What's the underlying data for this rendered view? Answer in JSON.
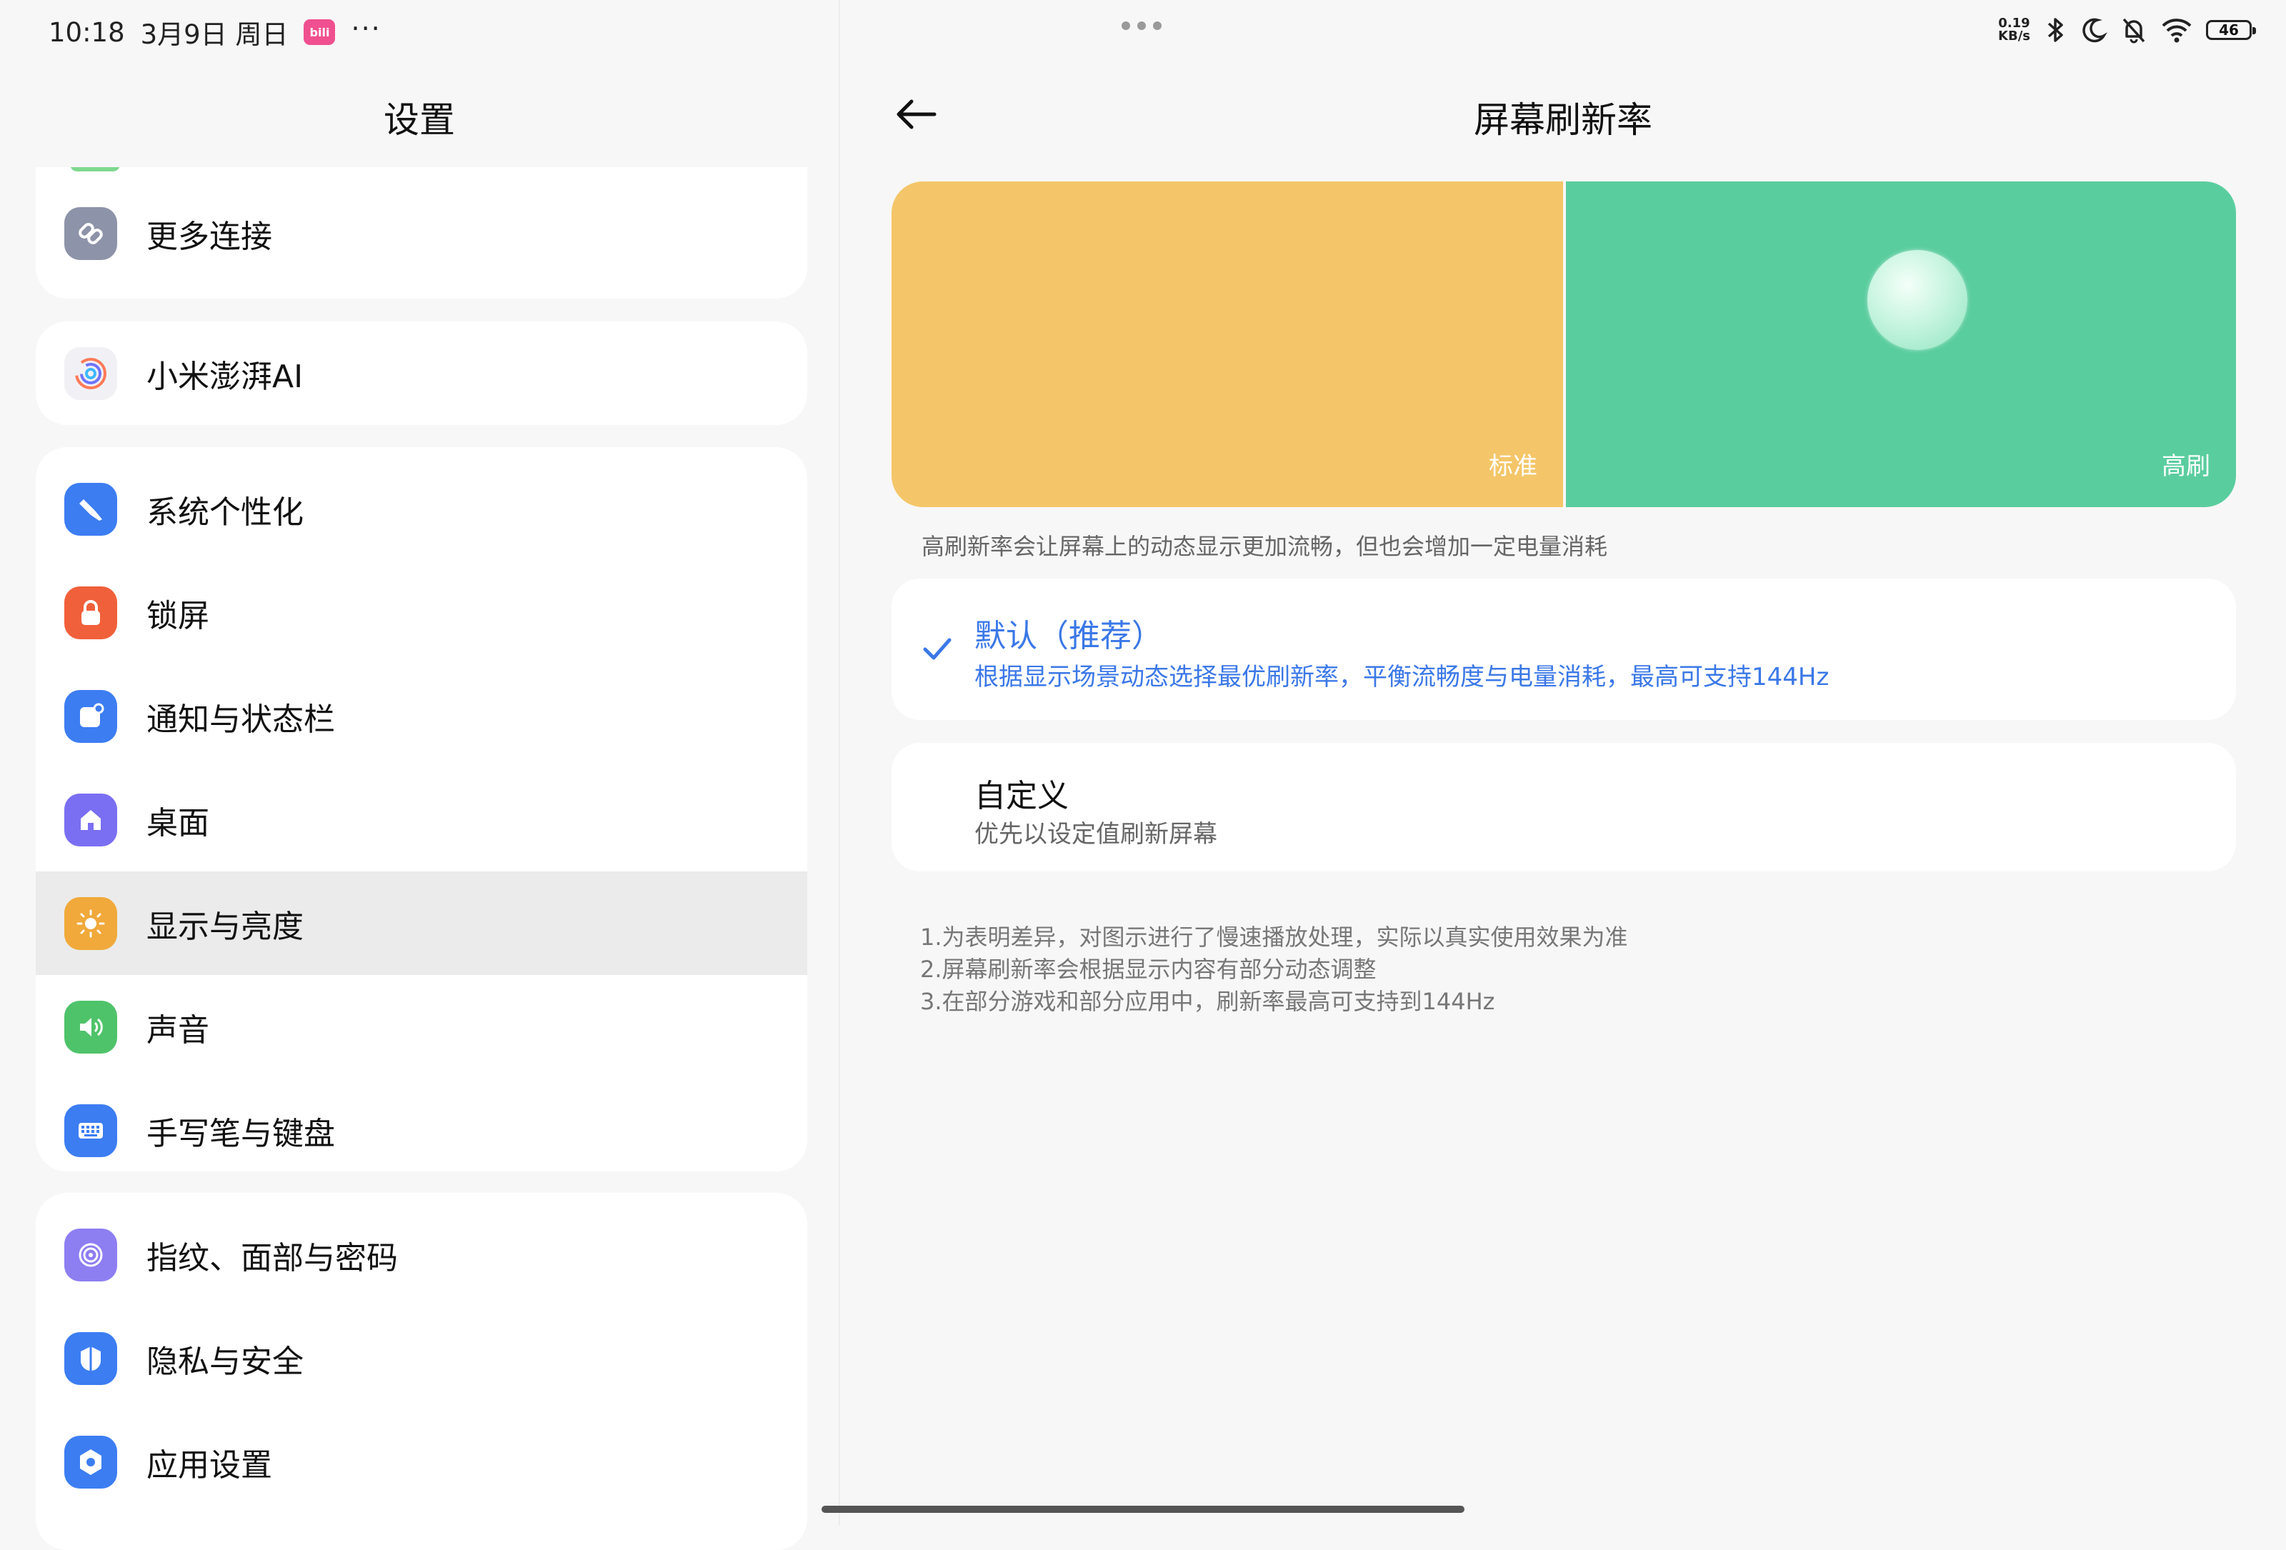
{
  "status_bar": {
    "time": "10:18",
    "date": "3月9日 周日",
    "app_badge": "bili",
    "more": "···",
    "net_speed_value": "0.19",
    "net_speed_unit": "KB/s",
    "battery": "46"
  },
  "left": {
    "title": "设置",
    "groups": [
      {
        "items": [
          {
            "label": "更多连接",
            "icon": "link-icon"
          }
        ]
      },
      {
        "items": [
          {
            "label": "小米澎湃AI",
            "icon": "ai-swirl-icon"
          }
        ]
      },
      {
        "items": [
          {
            "label": "系统个性化",
            "icon": "brush-icon"
          },
          {
            "label": "锁屏",
            "icon": "lock-icon"
          },
          {
            "label": "通知与状态栏",
            "icon": "notification-icon"
          },
          {
            "label": "桌面",
            "icon": "home-icon"
          },
          {
            "label": "显示与亮度",
            "icon": "sun-icon",
            "selected": true
          },
          {
            "label": "声音",
            "icon": "speaker-icon"
          },
          {
            "label": "手写笔与键盘",
            "icon": "keyboard-icon"
          }
        ]
      },
      {
        "items": [
          {
            "label": "指纹、面部与密码",
            "icon": "fingerprint-icon"
          },
          {
            "label": "隐私与安全",
            "icon": "shield-icon"
          },
          {
            "label": "应用设置",
            "icon": "app-settings-icon"
          }
        ]
      }
    ]
  },
  "right": {
    "title": "屏幕刷新率",
    "preview": {
      "left_label": "标准",
      "right_label": "高刷"
    },
    "description": "高刷新率会让屏幕上的动态显示更加流畅，但也会增加一定电量消耗",
    "options": [
      {
        "title": "默认（推荐）",
        "subtitle": "根据显示场景动态选择最优刷新率，平衡流畅度与电量消耗，最高可支持144Hz",
        "selected": true
      },
      {
        "title": "自定义",
        "subtitle": "优先以设定值刷新屏幕",
        "selected": false
      }
    ],
    "notes": [
      "1.为表明差异，对图示进行了慢速播放处理，实际以真实使用效果为准",
      "2.屏幕刷新率会根据显示内容有部分动态调整",
      "3.在部分游戏和部分应用中，刷新率最高可支持到144Hz"
    ]
  },
  "colors": {
    "accent_blue": "#3b78e7",
    "standard_yellow": "#f4c669",
    "high_green": "#5acd9e"
  }
}
